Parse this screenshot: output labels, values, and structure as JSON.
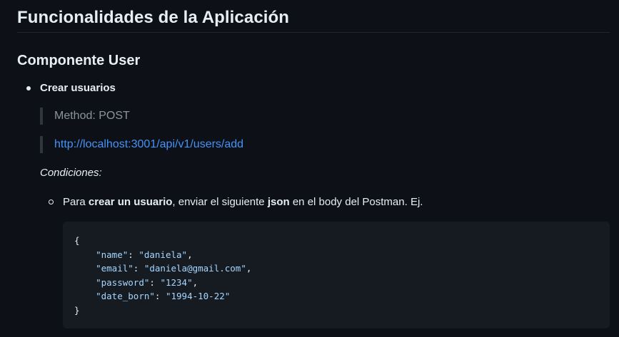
{
  "heading": "Funcionalidades de la Aplicación",
  "section": "Componente User",
  "item": {
    "title": "Crear usuarios",
    "method": "Method: POST",
    "url": "http://localhost:3001/api/v1/users/add",
    "conditions_label": "Condiciones:",
    "condition": {
      "p1": "Para ",
      "b1": "crear un usuario",
      "p2": ", enviar el siguiente ",
      "b2": "json",
      "p3": " en el body del Postman. Ej."
    }
  },
  "code": {
    "open": "{",
    "close": "}",
    "fields": [
      {
        "key": "\"name\"",
        "value": "\"daniela\"",
        "sep": ","
      },
      {
        "key": "\"email\"",
        "value": "\"daniela@gmail.com\"",
        "sep": ","
      },
      {
        "key": "\"password\"",
        "value": "\"1234\"",
        "sep": ","
      },
      {
        "key": "\"date_born\"",
        "value": "\"1994-10-22\"",
        "sep": ""
      }
    ]
  },
  "colors": {
    "background": "#0d1117",
    "text": "#e6edf3",
    "muted": "#8b949e",
    "link": "#4493f8",
    "code_bg": "#161b22",
    "code_string": "#a5d6ff"
  }
}
